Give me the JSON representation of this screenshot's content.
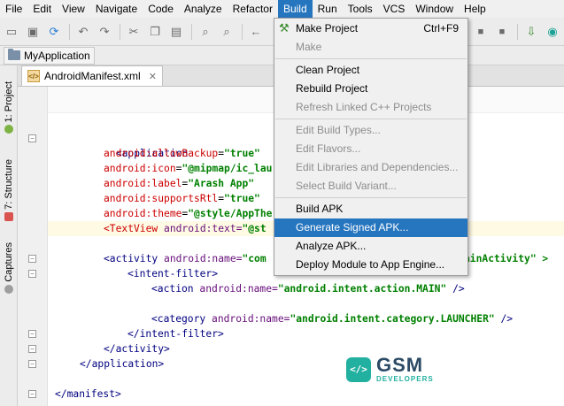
{
  "menubar": {
    "items": [
      "File",
      "Edit",
      "View",
      "Navigate",
      "Code",
      "Analyze",
      "Refactor",
      "Build",
      "Run",
      "Tools",
      "VCS",
      "Window",
      "Help"
    ],
    "active": "Build"
  },
  "navbar": {
    "project": "MyApplication"
  },
  "left_strip": {
    "tab_project": "1: Project",
    "tab_structure": "7: Structure",
    "tab_captures": "Captures"
  },
  "editor_tab": {
    "filename": "AndroidManifest.xml"
  },
  "code": {
    "l1_open": "<application",
    "l2_attr": "android:allowBackup",
    "l2_val": "\"true\"",
    "l3_attr": "android:icon",
    "l3_val": "\"@mipmap/ic_lau",
    "l4_attr": "android:label",
    "l4_val": "\"Arash App\"",
    "l5_attr": "android:supportsRtl",
    "l5_val": "\"true\"",
    "l6_attr": "android:theme",
    "l6_val": "\"@style/AppThe",
    "l7_tag": "<TextView",
    "l7_attr": " android:text=",
    "l7_val": "\"@st",
    "l8_tag": "<activity",
    "l8_attr": " android:name=",
    "l8_val": "\"com",
    "l8_tail": "ainActivity\" >",
    "l9": "<intent-filter>",
    "l10_tag": "<action",
    "l10_attr": " android:name=",
    "l10_val": "\"android.intent.action.MAIN\"",
    "l10_end": " />",
    "l11_tag": "<category",
    "l11_attr": " android:name=",
    "l11_val": "\"android.intent.category.LAUNCHER\"",
    "l11_end": " />",
    "l12": "</intent-filter>",
    "l13": "</activity>",
    "l14": "</application>",
    "l15": "</manifest>"
  },
  "build_menu": {
    "make_project": "Make Project",
    "make_project_shortcut": "Ctrl+F9",
    "make": "Make",
    "clean_project": "Clean Project",
    "rebuild_project": "Rebuild Project",
    "refresh_cpp": "Refresh Linked C++ Projects",
    "edit_build_types": "Edit Build Types...",
    "edit_flavors": "Edit Flavors...",
    "edit_libraries": "Edit Libraries and Dependencies...",
    "select_build_variant": "Select Build Variant...",
    "build_apk": "Build APK",
    "generate_signed_apk": "Generate Signed APK...",
    "analyze_apk": "Analyze APK...",
    "deploy_module": "Deploy Module to App Engine..."
  },
  "logo": {
    "badge": "</>",
    "main": "GSM",
    "sub": "DEVELOPERS"
  },
  "colors": {
    "accent": "#2675bf",
    "tag": "#000080",
    "attr": "#660e7a",
    "value": "#008000",
    "logo": "#22b0a0"
  }
}
